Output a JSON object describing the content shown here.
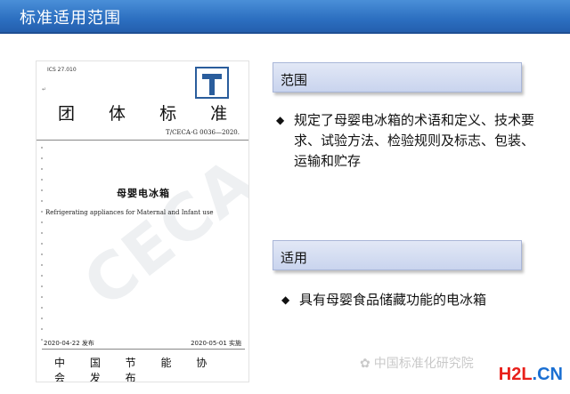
{
  "header": {
    "title": "标准适用范围"
  },
  "document": {
    "ics": "ICS 27.010",
    "heading": "团 体 标 准",
    "code": "T/CECA-G 0036—2020.",
    "name": "母婴电冰箱",
    "english_name": "Refrigerating appliances for Maternal and Infant use",
    "issue_date": "2020-04-22  发布",
    "implement_date": "2020-05-01  实施",
    "publisher": "中 国 节 能 协 会 发 布",
    "watermark": "CECA"
  },
  "sections": {
    "range": {
      "label": "范围",
      "bullet": "规定了母婴电冰箱的术语和定义、技术要求、试验方法、检验规则及标志、包装、运输和贮存"
    },
    "apply": {
      "label": "适用",
      "bullet": "具有母婴食品储藏功能的电冰箱"
    }
  },
  "watermark": {
    "text": "中国标准化研究院",
    "brand_part1": "H2L",
    "brand_part2": ".CN"
  },
  "colors": {
    "title_bar": "#2c6fc0",
    "section_box": "#c9d4ee",
    "brand_red": "#e8201b",
    "brand_blue": "#1a6fd2"
  }
}
